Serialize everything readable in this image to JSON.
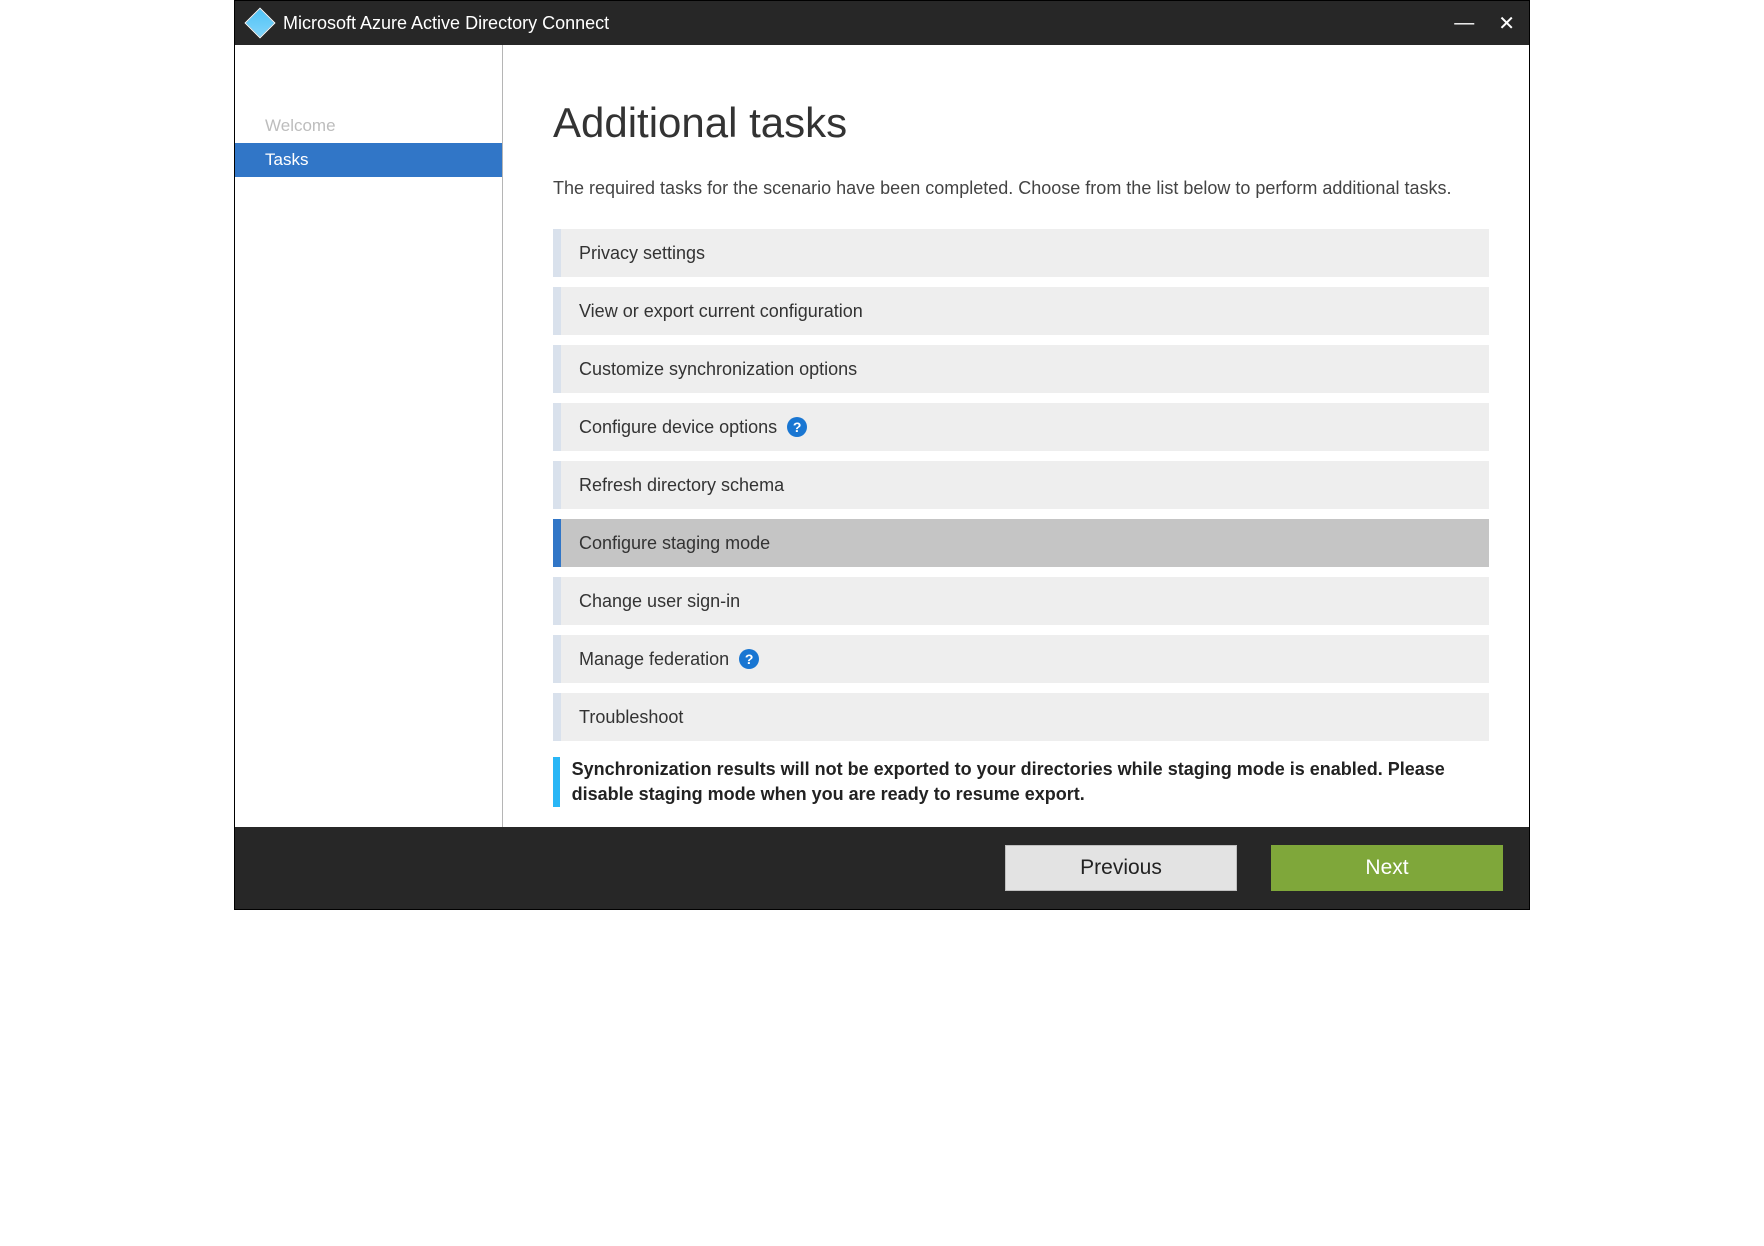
{
  "window": {
    "title": "Microsoft Azure Active Directory Connect"
  },
  "sidebar": {
    "items": [
      {
        "label": "Welcome",
        "active": false
      },
      {
        "label": "Tasks",
        "active": true
      }
    ]
  },
  "main": {
    "heading": "Additional tasks",
    "subtitle": "The required tasks for the scenario have been completed. Choose from the list below to perform additional tasks.",
    "tasks": [
      {
        "label": "Privacy settings",
        "help": false,
        "selected": false
      },
      {
        "label": "View or export current configuration",
        "help": false,
        "selected": false
      },
      {
        "label": "Customize synchronization options",
        "help": false,
        "selected": false
      },
      {
        "label": "Configure device options",
        "help": true,
        "selected": false
      },
      {
        "label": "Refresh directory schema",
        "help": false,
        "selected": false
      },
      {
        "label": "Configure staging mode",
        "help": false,
        "selected": true
      },
      {
        "label": "Change user sign-in",
        "help": false,
        "selected": false
      },
      {
        "label": "Manage federation",
        "help": true,
        "selected": false
      },
      {
        "label": "Troubleshoot",
        "help": false,
        "selected": false
      }
    ],
    "notice": "Synchronization results will not be exported to your directories while staging mode is enabled. Please disable staging mode when you are ready to resume export."
  },
  "footer": {
    "previous": "Previous",
    "next": "Next"
  },
  "icons": {
    "help_glyph": "?"
  }
}
